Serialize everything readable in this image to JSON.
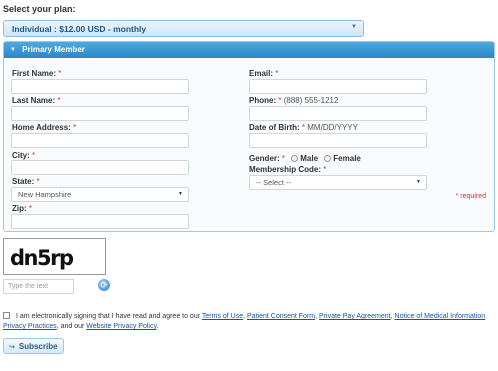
{
  "plan": {
    "label": "Select your plan:",
    "selected": "Individual : $12.00 USD - monthly"
  },
  "panel": {
    "title": "Primary Member"
  },
  "form": {
    "first_name": "First Name:",
    "last_name": "Last Name:",
    "home_address": "Home Address:",
    "city": "City:",
    "state": "State:",
    "state_value": "New Hampshire",
    "zip": "Zip:",
    "email": "Email:",
    "phone": "Phone:",
    "phone_hint": "(888) 555-1212",
    "dob": "Date of Birth:",
    "dob_hint": "MM/DD/YYYY",
    "gender": "Gender:",
    "gender_male": "Male",
    "gender_female": "Female",
    "membership_code": "Membership Code:",
    "membership_code_value": "-- Select --",
    "required_mark": "*",
    "required_note": "* required"
  },
  "captcha": {
    "text": "dn5rp",
    "input_placeholder": "Type the text",
    "refresh_icon": "refresh-icon"
  },
  "agreement": {
    "prefix": "I am electronically signing that I have read and agree to our",
    "terms": "Terms of Use",
    "sep1": ",",
    "consent": "Patient Consent Form",
    "sep2": ",",
    "private_pay": "Private Pay Agreement",
    "sep3": ",",
    "notice": "Notice of Medical Information Privacy Practices",
    "sep4": ", and our",
    "website_privacy": "Website Privacy Policy",
    "suffix": "."
  },
  "subscribe": {
    "label": "Subscribe",
    "icon": "subscribe-icon"
  },
  "colors": {
    "panel_header": "#2a88c7",
    "required": "#dd3333",
    "link": "#1f4f9f"
  }
}
